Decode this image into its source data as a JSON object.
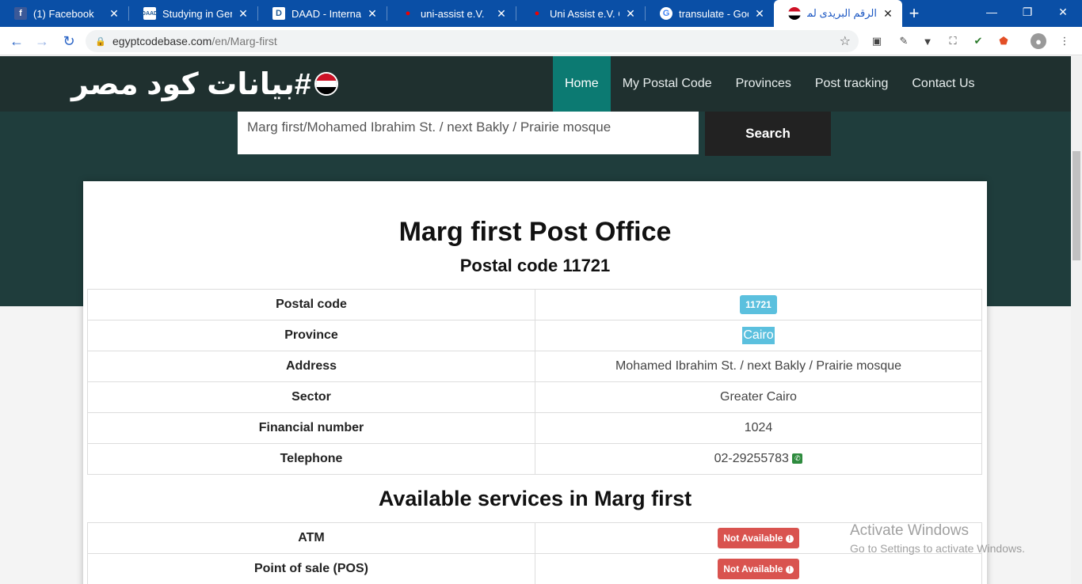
{
  "browser": {
    "tabs": [
      {
        "title": "(1) Facebook",
        "favicon": "facebook-icon",
        "color": "#3b5998",
        "glyph": "f"
      },
      {
        "title": "Studying in Germa",
        "favicon": "daad-icon",
        "color": "#ffffff",
        "glyph": "▦"
      },
      {
        "title": "DAAD - Internatio",
        "favicon": "daad-d-icon",
        "color": "#1f5a96",
        "glyph": "D"
      },
      {
        "title": "uni-assist e.V.",
        "favicon": "uni-assist-icon",
        "color": "#c00",
        "glyph": "●"
      },
      {
        "title": "Uni Assist e.V. Onl",
        "favicon": "uni-assist-icon",
        "color": "#c00",
        "glyph": "●"
      },
      {
        "title": "transulate - Googl",
        "favicon": "google-icon",
        "color": "#ffffff",
        "glyph": "G"
      },
      {
        "title": "الرقم البريدى لمكتب",
        "favicon": "egypt-flag-icon",
        "color": "#ffffff",
        "glyph": "●",
        "active": true
      }
    ],
    "url_domain": "egyptcodebase.com",
    "url_path": "/en/Marg-first"
  },
  "site": {
    "logo_text": "#بيانات كود مصر",
    "menu": [
      "Home",
      "My Postal Code",
      "Provinces",
      "Post tracking",
      "Contact Us"
    ],
    "active_menu": "Home"
  },
  "search": {
    "value": "Marg first/Mohamed Ibrahim St. / next Bakly / Prairie mosque",
    "button_label": "Search"
  },
  "office": {
    "title": "Marg first Post Office",
    "subtitle": "Postal code 11721",
    "rows": [
      {
        "key": "Postal code",
        "value": "11721"
      },
      {
        "key": "Province",
        "value": "Cairo"
      },
      {
        "key": "Address",
        "value": "Mohamed Ibrahim St. / next Bakly / Prairie mosque"
      },
      {
        "key": "Sector",
        "value": "Greater Cairo"
      },
      {
        "key": "Financial number",
        "value": "1024"
      },
      {
        "key": "Telephone",
        "value": "02-29255783"
      }
    ]
  },
  "services": {
    "title": "Available services in Marg first",
    "rows": [
      {
        "key": "ATM",
        "value": "Not Available"
      },
      {
        "key": "Point of sale (POS)",
        "value": "Not Available"
      }
    ]
  },
  "watermark": {
    "line1": "Activate Windows",
    "line2": "Go to Settings to activate Windows."
  }
}
